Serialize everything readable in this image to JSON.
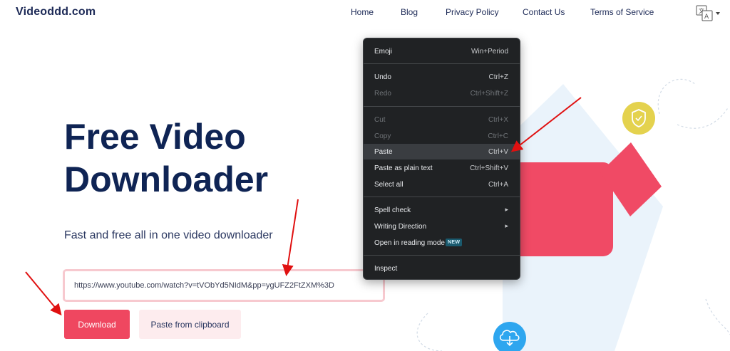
{
  "header": {
    "logo": "Videoddd.com",
    "nav": [
      {
        "label": "Home"
      },
      {
        "label": "Blog"
      },
      {
        "label": "Privacy Policy"
      },
      {
        "label": "Contact Us"
      },
      {
        "label": "Terms of Service"
      }
    ],
    "language_icon": "translate-icon",
    "language_caret": "▾"
  },
  "hero": {
    "title_line1": "Free Video",
    "title_line2": "Downloader",
    "subtitle": "Fast and free all in one video downloader"
  },
  "form": {
    "url_value": "https://www.youtube.com/watch?v=tVObYd5NIdM&pp=ygUFZ2FtZXM%3D",
    "download_label": "Download",
    "paste_label": "Paste from clipboard"
  },
  "context_menu": {
    "items": [
      {
        "label": "Emoji",
        "shortcut": "Win+Period",
        "enabled": true
      },
      {
        "label": "Undo",
        "shortcut": "Ctrl+Z",
        "enabled": true
      },
      {
        "label": "Redo",
        "shortcut": "Ctrl+Shift+Z",
        "enabled": false
      },
      {
        "label": "Cut",
        "shortcut": "Ctrl+X",
        "enabled": false
      },
      {
        "label": "Copy",
        "shortcut": "Ctrl+C",
        "enabled": false
      },
      {
        "label": "Paste",
        "shortcut": "Ctrl+V",
        "enabled": true,
        "highlighted": true
      },
      {
        "label": "Paste as plain text",
        "shortcut": "Ctrl+Shift+V",
        "enabled": true
      },
      {
        "label": "Select all",
        "shortcut": "Ctrl+A",
        "enabled": true
      },
      {
        "label": "Spell check",
        "submenu": true,
        "enabled": true
      },
      {
        "label": "Writing Direction",
        "submenu": true,
        "enabled": true
      },
      {
        "label": "Open in reading mode",
        "badge": "NEW",
        "enabled": true
      },
      {
        "label": "Inspect",
        "enabled": true
      }
    ],
    "submenu_arrow": "▸"
  },
  "icons": {
    "shield": "shield-check-icon",
    "cloud_download": "cloud-download-icon"
  },
  "colors": {
    "brand_navy": "#0f2454",
    "accent_red": "#ef4760",
    "shield_yellow": "#e4d24e",
    "cloud_blue": "#2ea6ef",
    "annotation_red": "#e01010"
  }
}
